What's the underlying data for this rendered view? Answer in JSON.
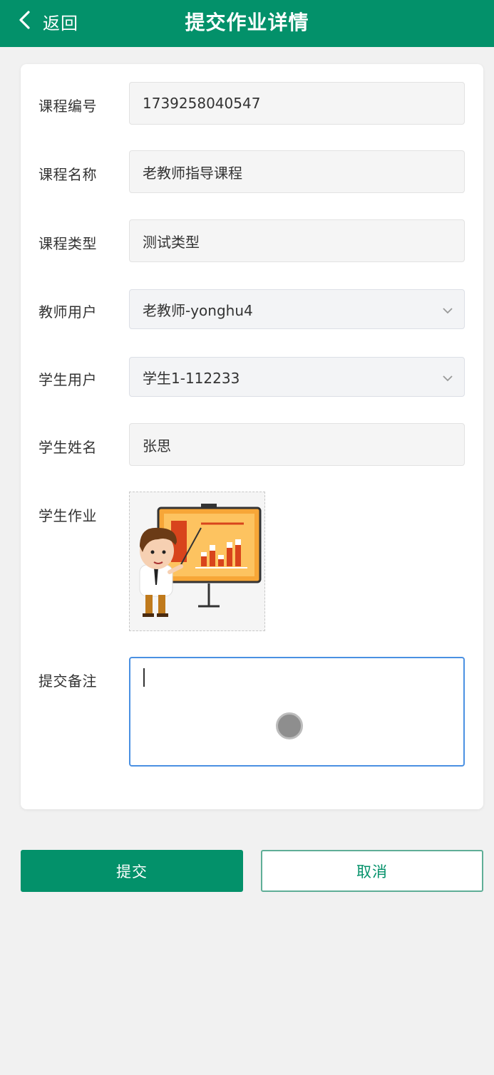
{
  "header": {
    "back_label": "返回",
    "title": "提交作业详情",
    "back_icon": "chevron-left-icon"
  },
  "form": {
    "course_no": {
      "label": "课程编号",
      "value": "1739258040547"
    },
    "course_name": {
      "label": "课程名称",
      "value": "老教师指导课程"
    },
    "course_type": {
      "label": "课程类型",
      "value": "测试类型"
    },
    "teacher_user": {
      "label": "教师用户",
      "value": "老教师-yonghu4",
      "icon": "chevron-down-icon"
    },
    "student_user": {
      "label": "学生用户",
      "value": "学生1-112233",
      "icon": "chevron-down-icon"
    },
    "student_name": {
      "label": "学生姓名",
      "value": "张思"
    },
    "homework": {
      "label": "学生作业",
      "image": "teacher-presentation-image"
    },
    "remark": {
      "label": "提交备注",
      "value": ""
    }
  },
  "buttons": {
    "submit": "提交",
    "cancel": "取消"
  },
  "colors": {
    "primary": "#03916a",
    "focus_border": "#4a90e2",
    "background": "#f1f1f1"
  }
}
